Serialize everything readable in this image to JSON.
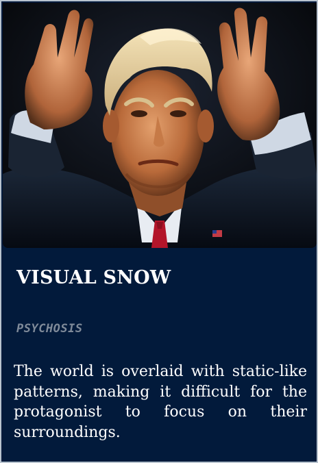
{
  "card": {
    "title": "VISUAL SNOW",
    "type": "PSYCHOSIS",
    "description": "The world is overlaid with static-like patterns, making it difficult for the protagonist to focus on their surroundings.",
    "colors": {
      "background": "#021a3b",
      "border": "#b9c3cf",
      "title": "#ffffff",
      "type_tag": "#7f8a99",
      "description": "#ffffff"
    }
  }
}
